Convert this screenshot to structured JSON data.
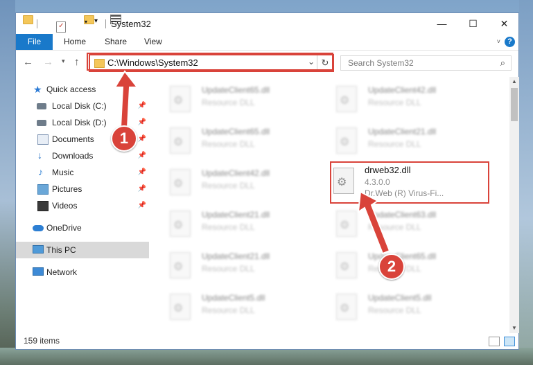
{
  "titlebar": {
    "title": "System32",
    "minimize": "—",
    "maximize": "☐",
    "close": "✕"
  },
  "ribbon": {
    "tabs": [
      "File",
      "Home",
      "Share",
      "View"
    ],
    "help": "?"
  },
  "address": {
    "path": "C:\\Windows\\System32",
    "search_placeholder": "Search System32"
  },
  "nav": {
    "items": [
      {
        "label": "Quick access",
        "icon": "star-icon"
      },
      {
        "label": "Local Disk (C:)",
        "icon": "drive-icon",
        "pinned": true
      },
      {
        "label": "Local Disk (D:)",
        "icon": "drive-icon",
        "pinned": true
      },
      {
        "label": "Documents",
        "icon": "documents-icon",
        "pinned": true
      },
      {
        "label": "Downloads",
        "icon": "download-icon",
        "pinned": true
      },
      {
        "label": "Music",
        "icon": "music-icon",
        "pinned": true
      },
      {
        "label": "Pictures",
        "icon": "pictures-icon",
        "pinned": true
      },
      {
        "label": "Videos",
        "icon": "videos-icon",
        "pinned": true
      },
      {
        "label": "OneDrive",
        "icon": "cloud-icon"
      },
      {
        "label": "This PC",
        "icon": "computer-icon",
        "selected": true
      },
      {
        "label": "Network",
        "icon": "network-icon"
      }
    ]
  },
  "files": {
    "left": [
      {
        "name": "UpdateClient65.dll",
        "type": "Resource DLL"
      },
      {
        "name": "UpdateClient65.dll",
        "type": "Resource DLL"
      },
      {
        "name": "UpdateClient42.dll",
        "type": "Resource DLL"
      },
      {
        "name": "UpdateClient21.dll",
        "type": "Resource DLL"
      },
      {
        "name": "UpdateClient21.dll",
        "type": "Resource DLL"
      },
      {
        "name": "UpdateClient5.dll",
        "type": "Resource DLL"
      }
    ],
    "right": [
      {
        "name": "UpdateClient42.dll",
        "type": "Resource DLL"
      },
      {
        "name": "UpdateClient21.dll",
        "type": "Resource DLL"
      },
      {
        "name": "drweb32.dll",
        "version": "4.3.0.0",
        "description": "Dr.Web (R) Virus-Fi..."
      },
      {
        "name": "UpdateClient63.dll",
        "type": "Resource DLL"
      },
      {
        "name": "UpdateClient65.dll",
        "type": "Resource DLL"
      },
      {
        "name": "UpdateClient5.dll",
        "type": "Resource DLL"
      }
    ]
  },
  "status": {
    "count": "159 items"
  },
  "annotations": {
    "step1": "1",
    "step2": "2",
    "color": "#d9433a"
  }
}
